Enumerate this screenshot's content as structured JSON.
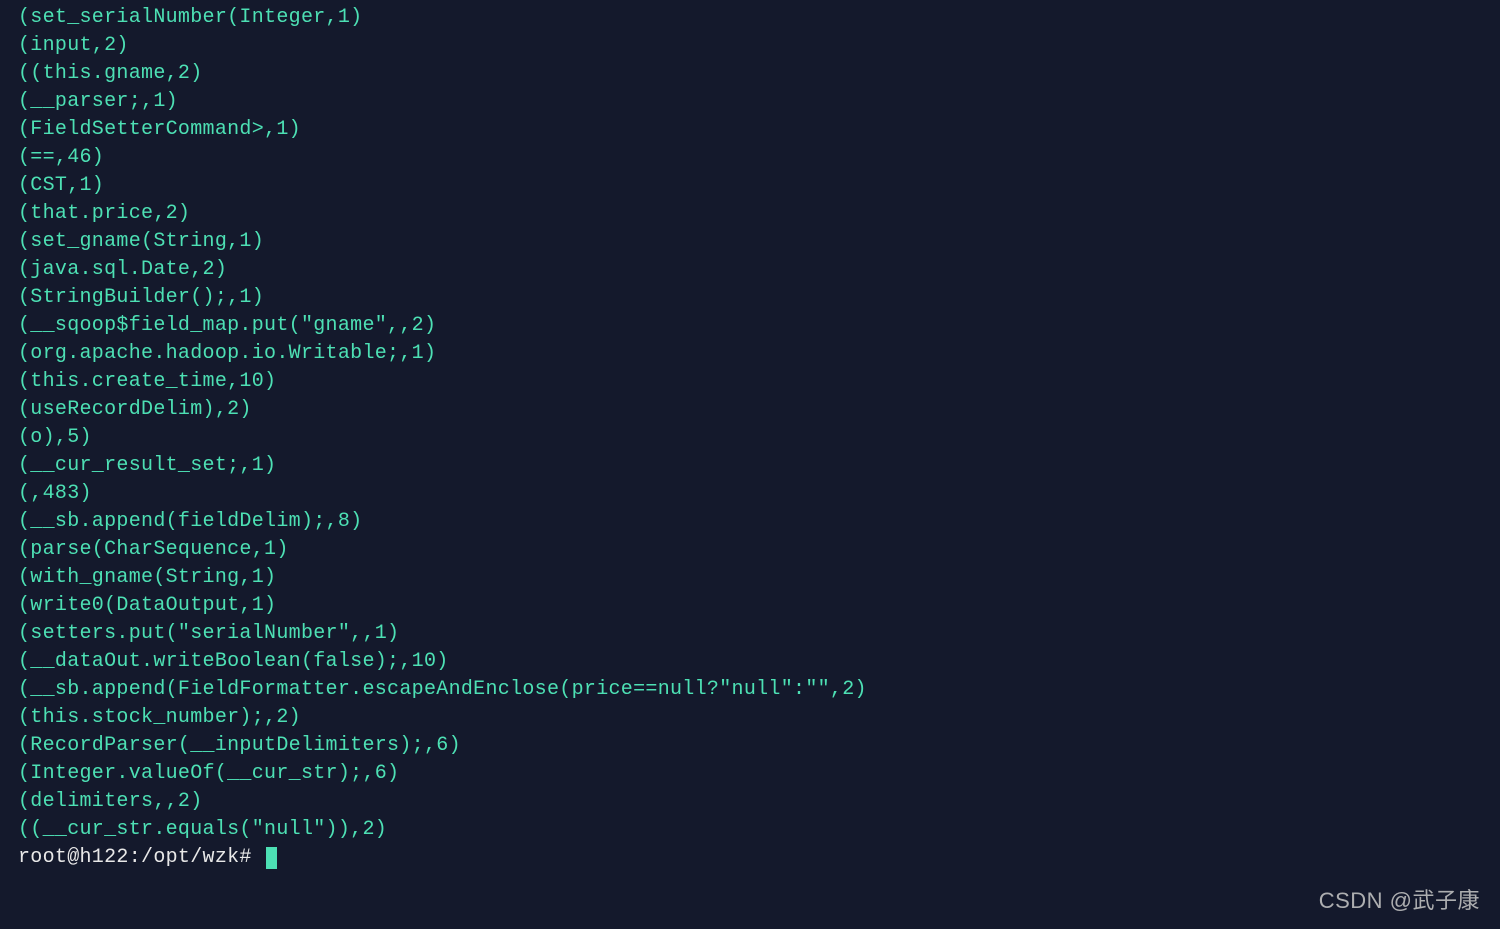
{
  "lines": [
    "(set_serialNumber(Integer,1)",
    "(input,2)",
    "((this.gname,2)",
    "(__parser;,1)",
    "(FieldSetterCommand>,1)",
    "(==,46)",
    "(CST,1)",
    "(that.price,2)",
    "(set_gname(String,1)",
    "(java.sql.Date,2)",
    "(StringBuilder();,1)",
    "(__sqoop$field_map.put(\"gname\",,2)",
    "(org.apache.hadoop.io.Writable;,1)",
    "(this.create_time,10)",
    "(useRecordDelim),2)",
    "(o),5)",
    "(__cur_result_set;,1)",
    "(,483)",
    "(__sb.append(fieldDelim);,8)",
    "(parse(CharSequence,1)",
    "(with_gname(String,1)",
    "(write0(DataOutput,1)",
    "(setters.put(\"serialNumber\",,1)",
    "(__dataOut.writeBoolean(false);,10)",
    "(__sb.append(FieldFormatter.escapeAndEnclose(price==null?\"null\":\"\",2)",
    "(this.stock_number);,2)",
    "(RecordParser(__inputDelimiters);,6)",
    "(Integer.valueOf(__cur_str);,6)",
    "(delimiters,,2)",
    "((__cur_str.equals(\"null\")),2)"
  ],
  "prompt": "root@h122:/opt/wzk# ",
  "watermark": "CSDN @武子康"
}
